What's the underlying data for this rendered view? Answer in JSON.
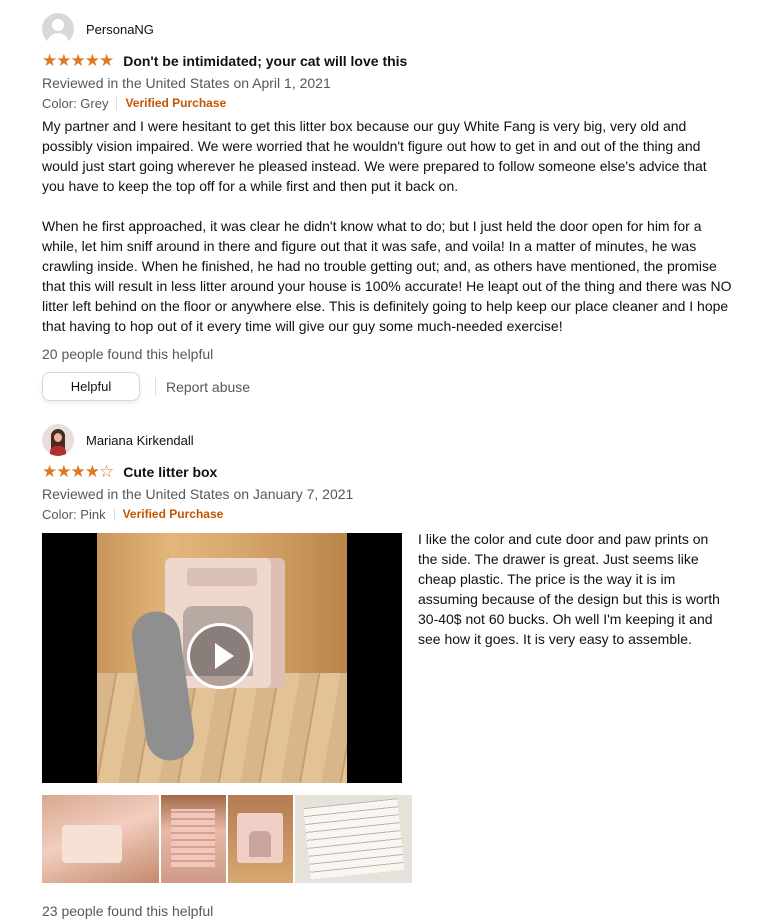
{
  "reviews": [
    {
      "reviewer": "PersonaNG",
      "stars": "★★★★★",
      "rating": 5,
      "title": "Don't be intimidated; your cat will love this",
      "meta": "Reviewed in the United States on April 1, 2021",
      "color": "Color: Grey",
      "verified": "Verified Purchase",
      "body": [
        "My partner and I were hesitant to get this litter box because our guy White Fang is very big, very old and possibly vision impaired. We were worried that he wouldn't figure out how to get in and out of the thing and would just start going wherever he pleased instead. We were prepared to follow someone else's advice that you have to keep the top off for a while first and then put it back on.",
        "When he first approached, it was clear he didn't know what to do; but I just held the door open for him for a while, let him sniff around in there and figure out that it was safe, and voila! In a matter of minutes, he was crawling inside. When he finished, he had no trouble getting out; and, as others have mentioned, the promise that this will result in less litter around your house is 100% accurate! He leapt out of the thing and there was NO litter left behind on the floor or anywhere else. This is definitely going to help keep our place cleaner and I hope that having to hop out of it every time will give our guy some much-needed exercise!"
      ],
      "helpful_count": "20 people found this helpful",
      "helpful_label": "Helpful",
      "report_label": "Report abuse"
    },
    {
      "reviewer": "Mariana Kirkendall",
      "stars_filled": "★★★★",
      "stars_empty": "☆",
      "rating": 4,
      "title": "Cute litter box",
      "meta": "Reviewed in the United States on January 7, 2021",
      "color": "Color: Pink",
      "verified": "Verified Purchase",
      "body": " I like the color and cute door and paw prints on the side. The drawer is great. Just seems like cheap plastic. The price is the way it is im assuming because of the design but this is worth 30-40$ not 60 bucks. Oh well I'm keeping it and see how it goes. It is very easy to assemble.",
      "helpful_count": "23 people found this helpful"
    }
  ],
  "colors": {
    "star": "#de7921",
    "verified": "#c45500",
    "muted_text": "#565959"
  }
}
